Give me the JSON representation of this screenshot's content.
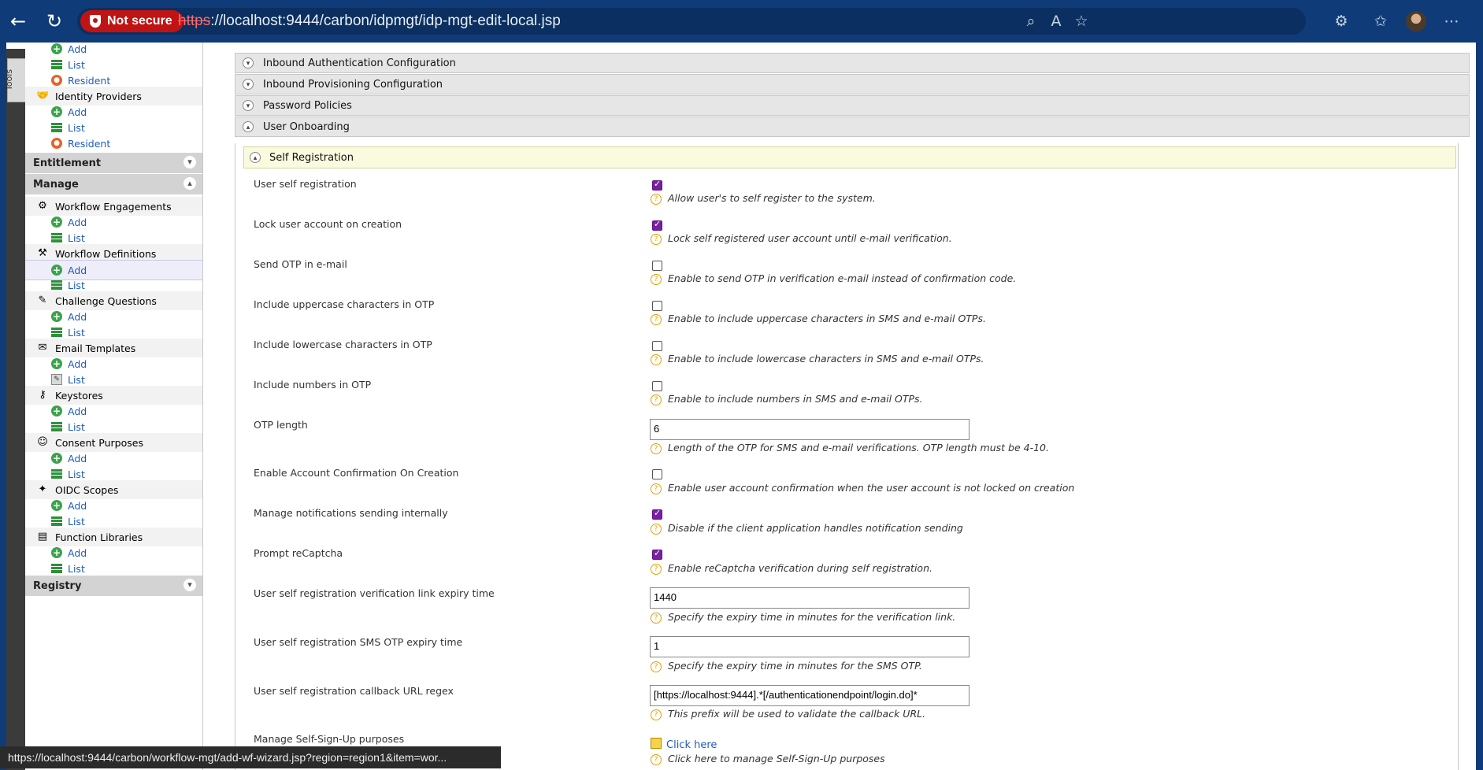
{
  "browser": {
    "security_label": "Not secure",
    "url_protocol": "https",
    "url_rest": "://localhost:9444/carbon/idpmgt/idp-mgt-edit-local.jsp",
    "status_url": "https://localhost:9444/carbon/workflow-mgt/add-wf-wizard.jsp?region=region1&item=wor..."
  },
  "tools_label": "Tools",
  "sidebar": {
    "top_items": [
      {
        "label": "Add",
        "icon": "add-icon"
      },
      {
        "label": "List",
        "icon": "list-icon"
      },
      {
        "label": "Resident",
        "icon": "resident-icon"
      }
    ],
    "identity_providers": {
      "label": "Identity Providers",
      "items": [
        {
          "label": "Add"
        },
        {
          "label": "List"
        },
        {
          "label": "Resident"
        }
      ]
    },
    "categories": {
      "entitlement": "Entitlement",
      "manage": "Manage",
      "registry": "Registry"
    },
    "manage_groups": [
      {
        "label": "Workflow Engagements",
        "items": [
          "Add",
          "List"
        ]
      },
      {
        "label": "Workflow Definitions",
        "items": [
          "Add",
          "List"
        ]
      },
      {
        "label": "Challenge Questions",
        "items": [
          "Add",
          "List"
        ]
      },
      {
        "label": "Email Templates",
        "items": [
          "Add",
          "List"
        ]
      },
      {
        "label": "Keystores",
        "items": [
          "Add",
          "List"
        ]
      },
      {
        "label": "Consent Purposes",
        "items": [
          "Add",
          "List"
        ]
      },
      {
        "label": "OIDC Scopes",
        "items": [
          "Add",
          "List"
        ]
      },
      {
        "label": "Function Libraries",
        "items": [
          "Add",
          "List"
        ]
      }
    ]
  },
  "sections": {
    "inbound_auth": "Inbound Authentication Configuration",
    "inbound_prov": "Inbound Provisioning Configuration",
    "password_policies": "Password Policies",
    "user_onboarding": "User Onboarding",
    "self_registration": "Self Registration"
  },
  "form": {
    "user_self_registration": {
      "label": "User self registration",
      "checked": true,
      "help": "Allow user's to self register to the system."
    },
    "lock_account": {
      "label": "Lock user account on creation",
      "checked": true,
      "help": "Lock self registered user account until e-mail verification."
    },
    "send_otp_email": {
      "label": "Send OTP in e-mail",
      "checked": false,
      "help": "Enable to send OTP in verification e-mail instead of confirmation code."
    },
    "otp_uppercase": {
      "label": "Include uppercase characters in OTP",
      "checked": false,
      "help": "Enable to include uppercase characters in SMS and e-mail OTPs."
    },
    "otp_lowercase": {
      "label": "Include lowercase characters in OTP",
      "checked": false,
      "help": "Enable to include lowercase characters in SMS and e-mail OTPs."
    },
    "otp_numbers": {
      "label": "Include numbers in OTP",
      "checked": false,
      "help": "Enable to include numbers in SMS and e-mail OTPs."
    },
    "otp_length": {
      "label": "OTP length",
      "value": "6",
      "help": "Length of the OTP for SMS and e-mail verifications. OTP length must be 4-10."
    },
    "account_confirmation": {
      "label": "Enable Account Confirmation On Creation",
      "checked": false,
      "help": "Enable user account confirmation when the user account is not locked on creation"
    },
    "manage_notifications": {
      "label": "Manage notifications sending internally",
      "checked": true,
      "help": "Disable if the client application handles notification sending"
    },
    "recaptcha": {
      "label": "Prompt reCaptcha",
      "checked": true,
      "help": "Enable reCaptcha verification during self registration."
    },
    "link_expiry": {
      "label": "User self registration verification link expiry time",
      "value": "1440",
      "help": "Specify the expiry time in minutes for the verification link."
    },
    "sms_otp_expiry": {
      "label": "User self registration SMS OTP expiry time",
      "value": "1",
      "help": "Specify the expiry time in minutes for the SMS OTP."
    },
    "callback_regex": {
      "label": "User self registration callback URL regex",
      "value": "[https://localhost:9444].*[/authenticationendpoint/login.do]*",
      "help": "This prefix will be used to validate the callback URL."
    },
    "self_signup_purposes": {
      "label": "Manage Self-Sign-Up purposes",
      "link": "Click here",
      "help": "Click here to manage Self-Sign-Up purposes"
    }
  }
}
